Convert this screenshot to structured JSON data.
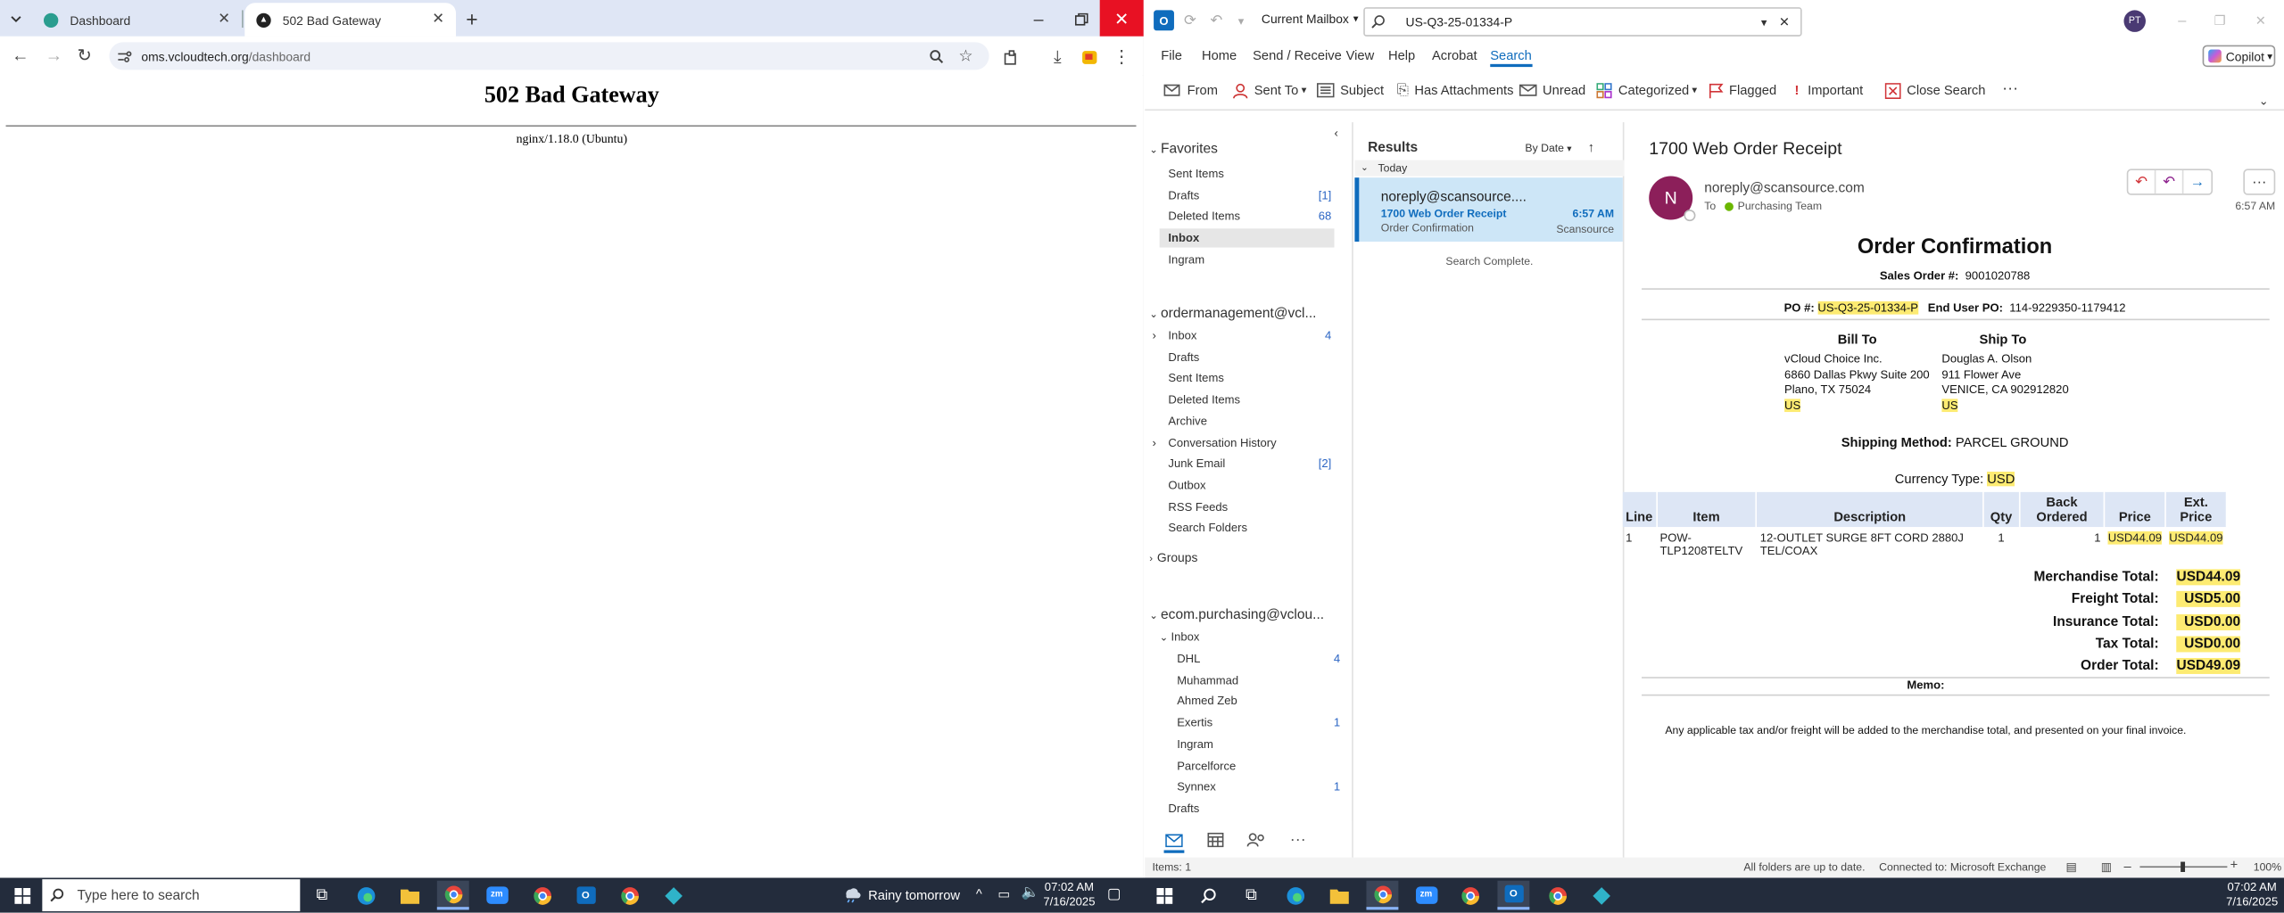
{
  "browser": {
    "tabs": [
      {
        "title": "Dashboard",
        "active": false
      },
      {
        "title": "502 Bad Gateway",
        "active": true
      }
    ],
    "address": "oms.vcloudtech.org/dashboard",
    "address_host": "oms.vcloudtech.org",
    "address_path": "/dashboard",
    "page": {
      "heading": "502 Bad Gateway",
      "server": "nginx/1.18.0 (Ubuntu)"
    }
  },
  "outlook": {
    "mailbox_scope": "Current Mailbox",
    "search_query": "US-Q3-25-01334-P",
    "avatar_initials": "PT",
    "copilot_label": "Copilot",
    "menu": [
      "File",
      "Home",
      "Send / Receive",
      "View",
      "Help",
      "Acrobat",
      "Search"
    ],
    "active_menu": "Search",
    "ribbon": {
      "from": "From",
      "sent_to": "Sent To",
      "subject": "Subject",
      "has_attachments": "Has Attachments",
      "unread": "Unread",
      "categorized": "Categorized",
      "flagged": "Flagged",
      "important": "Important",
      "close_search": "Close Search"
    },
    "folders": {
      "favorites_label": "Favorites",
      "favorites": [
        {
          "name": "Sent Items",
          "count": ""
        },
        {
          "name": "Drafts",
          "count": "[1]"
        },
        {
          "name": "Deleted Items",
          "count": "68"
        },
        {
          "name": "Inbox",
          "count": "",
          "selected": true
        },
        {
          "name": "Ingram",
          "count": ""
        }
      ],
      "account1_label": "ordermanagement@vcl...",
      "account1": [
        {
          "name": "Inbox",
          "count": "4",
          "expandable": true
        },
        {
          "name": "Drafts",
          "count": ""
        },
        {
          "name": "Sent Items",
          "count": ""
        },
        {
          "name": "Deleted Items",
          "count": ""
        },
        {
          "name": "Archive",
          "count": ""
        },
        {
          "name": "Conversation History",
          "count": "",
          "expandable": true
        },
        {
          "name": "Junk Email",
          "count": "[2]"
        },
        {
          "name": "Outbox",
          "count": ""
        },
        {
          "name": "RSS Feeds",
          "count": ""
        },
        {
          "name": "Search Folders",
          "count": ""
        }
      ],
      "groups_label": "Groups",
      "account2_label": "ecom.purchasing@vclou...",
      "account2_inbox": "Inbox",
      "account2": [
        {
          "name": "DHL",
          "count": "4"
        },
        {
          "name": "Muhammad",
          "count": ""
        },
        {
          "name": "Ahmed Zeb",
          "count": ""
        },
        {
          "name": "Exertis",
          "count": "1"
        },
        {
          "name": "Ingram",
          "count": ""
        },
        {
          "name": "Parcelforce",
          "count": ""
        },
        {
          "name": "Synnex",
          "count": "1"
        }
      ],
      "account2_drafts": "Drafts"
    },
    "results": {
      "label": "Results",
      "sort": "By Date",
      "group": "Today",
      "message": {
        "sender": "noreply@scansource....",
        "subject": "1700 Web Order Receipt",
        "preview": "Order Confirmation",
        "time": "6:57 AM",
        "tag": "Scansource"
      },
      "status": "Search Complete."
    },
    "reading": {
      "subject": "1700 Web Order Receipt",
      "avatar": "N",
      "from": "noreply@scansource.com",
      "to_label": "To",
      "to": "Purchasing Team",
      "time": "6:57 AM"
    },
    "order": {
      "title": "Order Confirmation",
      "sales_order_label": "Sales Order #:",
      "sales_order": "9001020788",
      "po_label": "PO #:",
      "po": "US-Q3-25-01334-P",
      "end_user_po_label": "End User PO:",
      "end_user_po": "114-9229350-1179412",
      "bill_to_label": "Bill To",
      "bill_to": [
        "vCloud Choice Inc.",
        "6860 Dallas Pkwy Suite 200",
        "Plano, TX 75024",
        "US"
      ],
      "ship_to_label": "Ship To",
      "ship_to": [
        "Douglas A. Olson",
        "911 Flower Ave",
        "VENICE, CA 902912820",
        "US"
      ],
      "shipping_method_label": "Shipping Method:",
      "shipping_method": "PARCEL GROUND",
      "currency_label": "Currency Type:",
      "currency": "USD",
      "columns": [
        "Line",
        "Item",
        "Description",
        "Qty",
        "Back Ordered",
        "Price",
        "Ext. Price"
      ],
      "rows": [
        {
          "line": "1",
          "item": "POW-TLP1208TELTV",
          "description": "12-OUTLET SURGE 8FT CORD 2880J TEL/COAX",
          "qty": "1",
          "back_ordered": "1",
          "price": "USD44.09",
          "ext_price": "USD44.09"
        }
      ],
      "totals": [
        {
          "label": "Merchandise Total:",
          "value": "USD44.09"
        },
        {
          "label": "Freight Total:",
          "value": "USD5.00"
        },
        {
          "label": "Insurance Total:",
          "value": "USD0.00"
        },
        {
          "label": "Tax Total:",
          "value": "USD0.00"
        },
        {
          "label": "Order Total:",
          "value": "USD49.09"
        }
      ],
      "memo_label": "Memo:",
      "footer": "Any applicable tax and/or freight will be added to the merchandise total, and presented on your final invoice."
    },
    "status": {
      "items": "Items: 1",
      "sync": "All folders are up to date.",
      "connection": "Connected to: Microsoft Exchange",
      "zoom": "100%"
    }
  },
  "taskbar": {
    "search_placeholder": "Type here to search",
    "weather": "Rainy tomorrow",
    "time_left": "07:02 AM",
    "date_left": "7/16/2025",
    "time_right": "07:02 AM",
    "date_right": "7/16/2025"
  }
}
